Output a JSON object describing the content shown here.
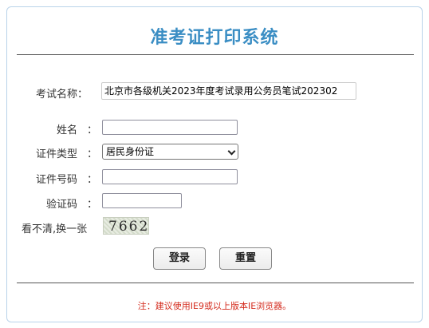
{
  "page": {
    "title": "准考证打印系统"
  },
  "form": {
    "exam_name": {
      "label": "考试名称：",
      "value": "北京市各级机关2023年度考试录用公务员笔试202302"
    },
    "name": {
      "label": "姓名",
      "colon": "：",
      "value": ""
    },
    "id_type": {
      "label": "证件类型",
      "colon": "：",
      "selected": "居民身份证"
    },
    "id_number": {
      "label": "证件号码",
      "colon": "：",
      "value": ""
    },
    "captcha": {
      "label": "验证码",
      "colon": "：",
      "value": ""
    },
    "refresh": {
      "label": "看不清,换一张",
      "code": "7662"
    }
  },
  "buttons": {
    "login": "登录",
    "reset": "重置"
  },
  "notice": "注：建议使用IE9或以上版本IE浏览器。"
}
